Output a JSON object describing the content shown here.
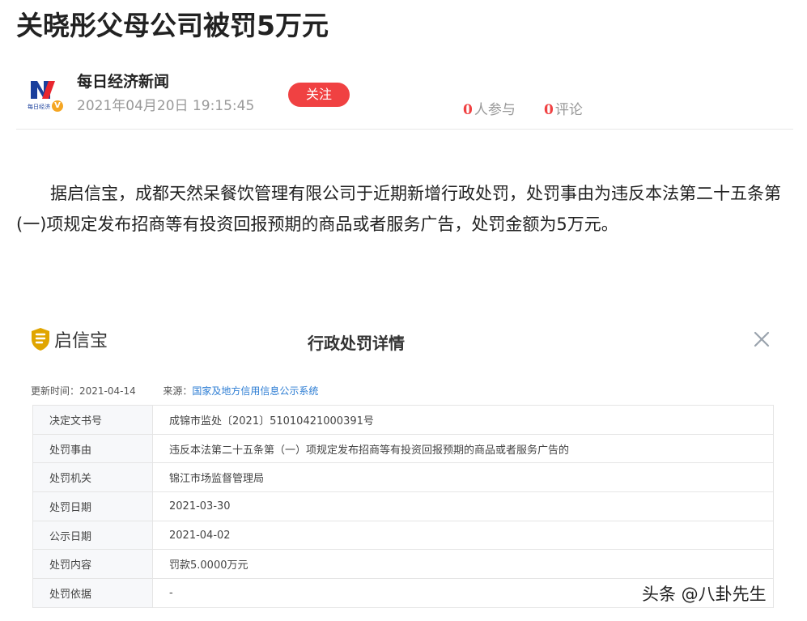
{
  "article": {
    "title": "关晓彤父母公司被罚5万元",
    "author": {
      "name": "每日经济新闻",
      "logo_text": "每日经济新闻",
      "verified_badge": "V",
      "publish_time": "2021年04月20日 19:15:45",
      "follow_label": "关注"
    },
    "stats": {
      "participants_count": "0",
      "participants_label": "人参与",
      "comments_count": "0",
      "comments_label": "评论"
    },
    "paragraph": "据启信宝，成都天然呆餐饮管理有限公司于近期新增行政处罚，处罚事由为违反本法第二十五条第(一)项规定发布招商等有投资回报预期的商品或者服务广告，处罚金额为5万元。"
  },
  "card": {
    "brand": "启信宝",
    "title": "行政处罚详情",
    "close_icon": "close-icon",
    "update_label": "更新时间：2021-04-14",
    "source_label": "来源：",
    "source_value": "国家及地方信用信息公示系统",
    "rows": [
      {
        "key": "决定文书号",
        "value": "成锦市监处〔2021〕51010421000391号"
      },
      {
        "key": "处罚事由",
        "value": "违反本法第二十五条第（一）项规定发布招商等有投资回报预期的商品或者服务广告的"
      },
      {
        "key": "处罚机关",
        "value": "锦江市场监督管理局"
      },
      {
        "key": "处罚日期",
        "value": "2021-03-30"
      },
      {
        "key": "公示日期",
        "value": "2021-04-02"
      },
      {
        "key": "处罚内容",
        "value": "罚款5.0000万元"
      },
      {
        "key": "处罚依据",
        "value": "-"
      }
    ]
  },
  "watermark": "头条 @八卦先生",
  "colors": {
    "accent_red": "#f04142",
    "link_blue": "#2b7cd3",
    "badge_orange": "#f5a623",
    "shield_gold": "#e0a500"
  }
}
